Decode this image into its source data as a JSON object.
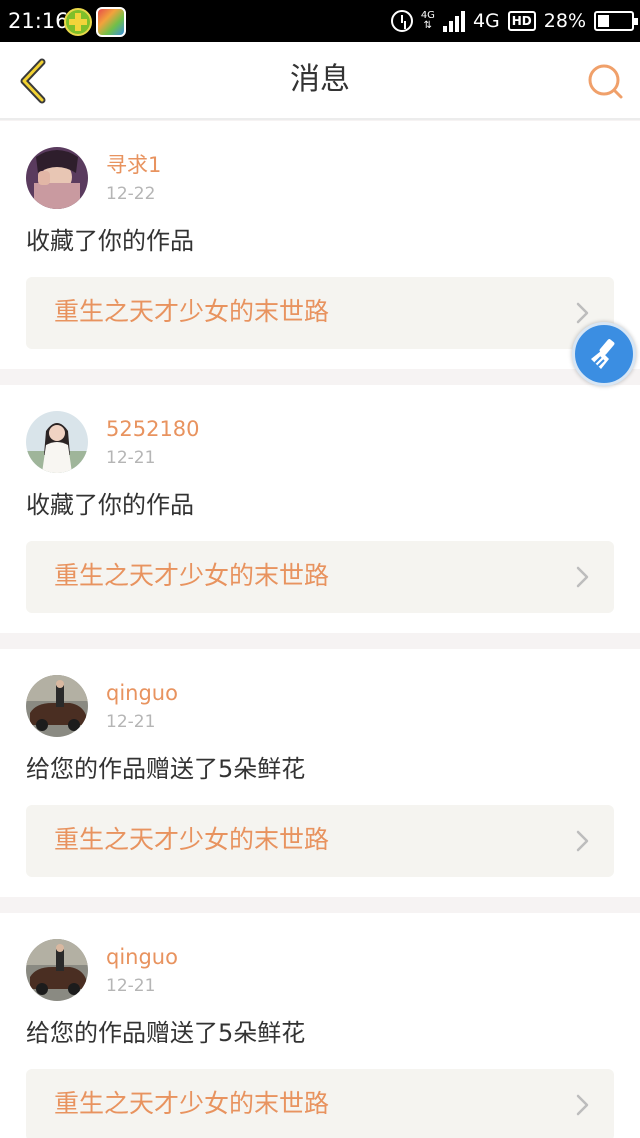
{
  "statusbar": {
    "time": "21:16",
    "network": "4G",
    "network_small": "4G",
    "hd_badge": "HD",
    "battery": "28%"
  },
  "header": {
    "title": "消息",
    "back_icon": "back-chevron-icon",
    "search_icon": "search-icon"
  },
  "accent_color": "#e8935f",
  "messages": [
    {
      "username": "寻求1",
      "date": "12-22",
      "action": "收藏了你的作品",
      "work_title": "重生之天才少女的末世路"
    },
    {
      "username": "5252180",
      "date": "12-21",
      "action": "收藏了你的作品",
      "work_title": "重生之天才少女的末世路"
    },
    {
      "username": "qinguo",
      "date": "12-21",
      "action": "给您的作品赠送了5朵鲜花",
      "work_title": "重生之天才少女的末世路"
    },
    {
      "username": "qinguo",
      "date": "12-21",
      "action": "给您的作品赠送了5朵鲜花",
      "work_title": "重生之天才少女的末世路"
    }
  ],
  "floating_button": {
    "icon": "brush-icon"
  }
}
